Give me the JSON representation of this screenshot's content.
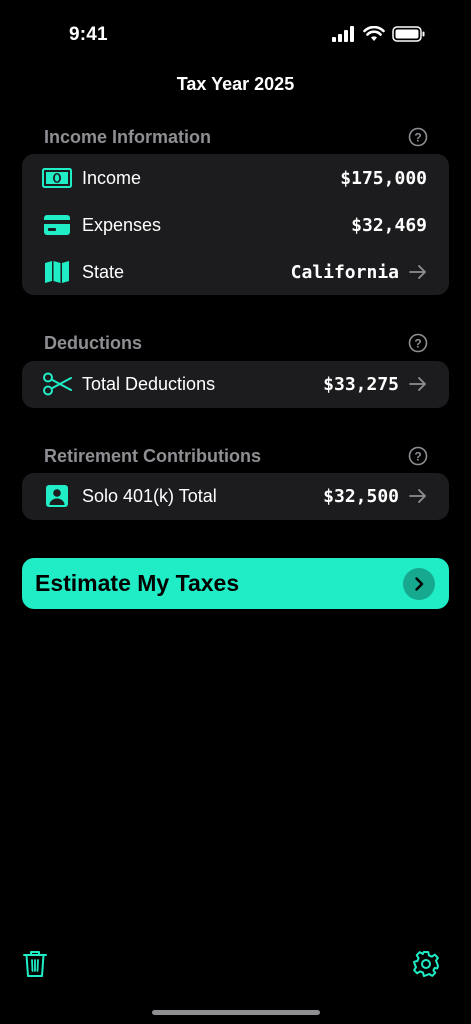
{
  "status_bar": {
    "time": "9:41"
  },
  "page_title": "Tax Year 2025",
  "accent_color": "#20ecc6",
  "sections": {
    "income": {
      "title": "Income Information",
      "rows": [
        {
          "label": "Income",
          "value": "$175,000",
          "icon": "cash-icon"
        },
        {
          "label": "Expenses",
          "value": "$32,469",
          "icon": "credit-card-icon"
        },
        {
          "label": "State",
          "value": "California",
          "icon": "map-icon"
        }
      ]
    },
    "deductions": {
      "title": "Deductions",
      "rows": [
        {
          "label": "Total Deductions",
          "value": "$33,275",
          "icon": "scissors-icon"
        }
      ]
    },
    "retirement": {
      "title": "Retirement Contributions",
      "rows": [
        {
          "label": "Solo 401(k) Total",
          "value": "$32,500",
          "icon": "person-badge-icon"
        }
      ]
    }
  },
  "cta": {
    "label": "Estimate My Taxes"
  }
}
